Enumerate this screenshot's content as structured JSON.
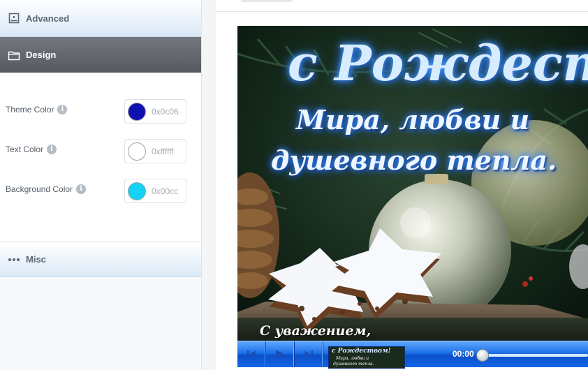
{
  "sidebar": {
    "advanced": {
      "label": "Advanced",
      "icon": "video-frame-icon"
    },
    "design": {
      "label": "Design",
      "icon": "folder-icon",
      "colors": [
        {
          "label": "Theme Color",
          "value": "0x0c06",
          "swatch": "#1010b0"
        },
        {
          "label": "Text Color",
          "value": "0xffffff",
          "swatch": "#ffffff"
        },
        {
          "label": "Background Color",
          "value": "0x00cc",
          "swatch": "#12d3f5"
        }
      ]
    },
    "misc": {
      "label": "Misc",
      "icon": "more-horizontal-icon"
    }
  },
  "preview": {
    "title": "с Рождеством!",
    "line1": "Мира, любви и",
    "line2": "душевного тепла.",
    "signature": "С уважением,",
    "player": {
      "time": "00:00",
      "progress": 0,
      "thumbnail": {
        "title": "с Рождеством!",
        "line1": "Мира, любви и",
        "line2": "душевного тепла."
      }
    }
  }
}
